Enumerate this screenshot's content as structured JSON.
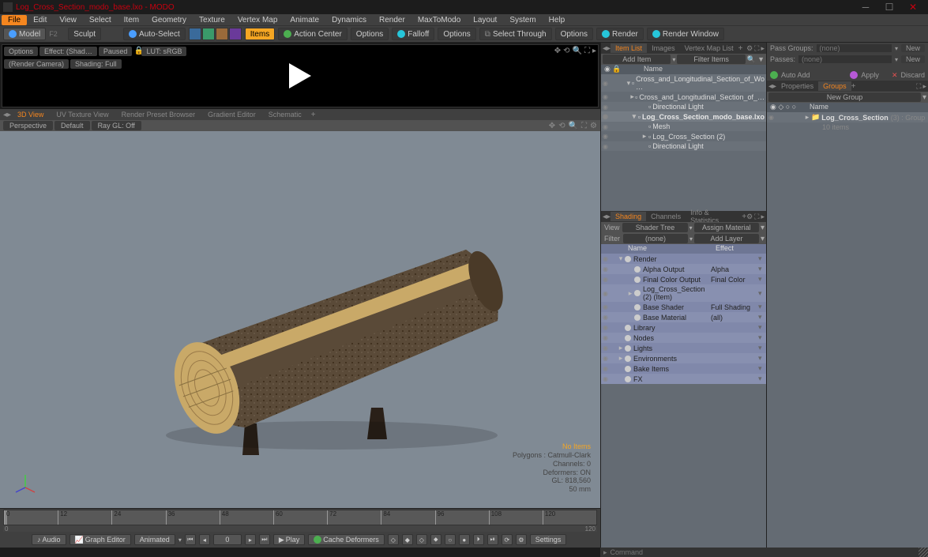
{
  "title": "Log_Cross_Section_modo_base.lxo - MODO",
  "menubar": [
    "File",
    "Edit",
    "View",
    "Select",
    "Item",
    "Geometry",
    "Texture",
    "Vertex Map",
    "Animate",
    "Dynamics",
    "Render",
    "MaxToModo",
    "Layout",
    "System",
    "Help"
  ],
  "toolbar": {
    "model": "Model",
    "f2": "F2",
    "sculpt": "Sculpt",
    "auto_select": "Auto-Select",
    "items": "Items",
    "action_center": "Action Center",
    "options1": "Options",
    "falloff": "Falloff",
    "options2": "Options",
    "select_through": "Select Through",
    "options3": "Options",
    "render": "Render",
    "render_window": "Render Window"
  },
  "preview": {
    "options": "Options",
    "effect": "Effect: (Shad…",
    "paused": "Paused",
    "lut": "LUT: sRGB",
    "render_camera": "(Render Camera)",
    "shading": "Shading: Full"
  },
  "view_tabs": [
    "3D View",
    "UV Texture View",
    "Render Preset Browser",
    "Gradient Editor",
    "Schematic"
  ],
  "vp": {
    "perspective": "Perspective",
    "default": "Default",
    "ray": "Ray GL: Off"
  },
  "stats": {
    "noitems": "No Items",
    "poly": "Polygons : Catmull-Clark",
    "chan": "Channels: 0",
    "def": "Deformers: ON",
    "gl": "GL: 818,560",
    "mm": "50 mm"
  },
  "timeline": {
    "ticks": [
      "0",
      "12",
      "24",
      "36",
      "48",
      "60",
      "72",
      "84",
      "96",
      "108",
      "120"
    ],
    "start": "0",
    "end": "120"
  },
  "transport": {
    "audio": "Audio",
    "graph": "Graph Editor",
    "animated": "Animated",
    "frame": "0",
    "play": "Play",
    "cache": "Cache Deformers",
    "settings": "Settings"
  },
  "item_panel": {
    "tabs": [
      "Item List",
      "Images",
      "Vertex Map List"
    ],
    "add_item": "Add Item",
    "filter_items": "Filter Items",
    "hdr": "Name",
    "rows": [
      {
        "name": "Cross_and_Longitudinal_Section_of_Wo …",
        "indent": 1,
        "exp": "▾",
        "sel": false
      },
      {
        "name": "Cross_and_Longitudinal_Section_of_…",
        "indent": 2,
        "exp": "▸",
        "sel": false
      },
      {
        "name": "Directional Light",
        "indent": 2,
        "exp": "",
        "sel": false
      },
      {
        "name": "Log_Cross_Section_modo_base.lxo",
        "indent": 1,
        "exp": "▾",
        "sel": true
      },
      {
        "name": "Mesh",
        "indent": 2,
        "exp": "",
        "sel": false
      },
      {
        "name": "Log_Cross_Section (2)",
        "indent": 2,
        "exp": "▸",
        "sel": false
      },
      {
        "name": "Directional Light",
        "indent": 2,
        "exp": "",
        "sel": false
      }
    ]
  },
  "shading_panel": {
    "tabs": [
      "Shading",
      "Channels",
      "Info & Statistics"
    ],
    "view": "View",
    "shader_tree": "Shader Tree",
    "assign": "Assign Material",
    "filter": "Filter",
    "none": "(none)",
    "add_layer": "Add Layer",
    "hdr_name": "Name",
    "hdr_effect": "Effect",
    "rows": [
      {
        "name": "Render",
        "effect": "",
        "exp": "▾",
        "indent": 0
      },
      {
        "name": "Alpha Output",
        "effect": "Alpha",
        "exp": "",
        "indent": 1
      },
      {
        "name": "Final Color Output",
        "effect": "Final Color",
        "exp": "",
        "indent": 1
      },
      {
        "name": "Log_Cross_Section (2) (Item)",
        "effect": "",
        "exp": "▸",
        "indent": 1
      },
      {
        "name": "Base Shader",
        "effect": "Full Shading",
        "exp": "",
        "indent": 1
      },
      {
        "name": "Base Material",
        "effect": "(all)",
        "exp": "",
        "indent": 1
      },
      {
        "name": "Library",
        "effect": "",
        "exp": "",
        "indent": 0
      },
      {
        "name": "Nodes",
        "effect": "",
        "exp": "",
        "indent": 0
      },
      {
        "name": "Lights",
        "effect": "",
        "exp": "▸",
        "indent": 0
      },
      {
        "name": "Environments",
        "effect": "",
        "exp": "▸",
        "indent": 0
      },
      {
        "name": "Bake Items",
        "effect": "",
        "exp": "",
        "indent": 0
      },
      {
        "name": "FX",
        "effect": "",
        "exp": "",
        "indent": 0
      }
    ]
  },
  "right2": {
    "pass_groups": "Pass Groups:",
    "passes": "Passes:",
    "none": "(none)",
    "new": "New",
    "auto_add": "Auto Add",
    "apply": "Apply",
    "discard": "Discard",
    "properties": "Properties",
    "groups": "Groups",
    "new_group": "New Group",
    "hdr": "Name",
    "item": "Log_Cross_Section",
    "item_suffix": "(3) : Group",
    "sub": "10 items",
    "command": "Command"
  }
}
